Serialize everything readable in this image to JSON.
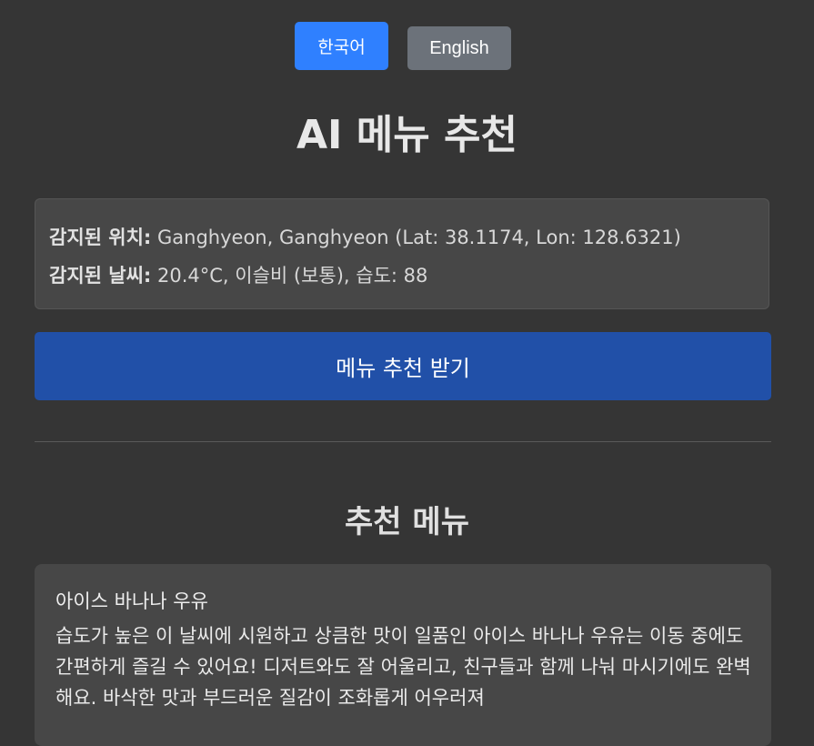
{
  "language_switcher": {
    "korean_label": "한국어",
    "english_label": "English"
  },
  "header": {
    "title": "AI 메뉴 추천"
  },
  "info": {
    "location_label": "감지된 위치:",
    "location_value": "Ganghyeon, Ganghyeon (Lat: 38.1174, Lon: 128.6321)",
    "weather_label": "감지된 날씨:",
    "weather_value": "20.4°C, 이슬비 (보통), 습도: 88"
  },
  "actions": {
    "recommend_label": "메뉴 추천 받기"
  },
  "recommendation": {
    "section_title": "추천 메뉴",
    "menu_name": "아이스 바나나 우유",
    "description": "습도가 높은 이 날씨에 시원하고 상큼한 맛이 일품인 아이스 바나나 우유는 이동 중에도 간편하게 즐길 수 있어요! 디저트와도 잘 어울리고, 친구들과 함께 나눠 마시기에도 완벽해요. 바삭한 맛과 부드러운 질감이 조화롭게 어우러져"
  },
  "colors": {
    "background": "#353535",
    "korean_button": "#2f80ff",
    "english_button": "#6c727a",
    "recommend_button": "#2150a8",
    "panel": "#474747"
  }
}
